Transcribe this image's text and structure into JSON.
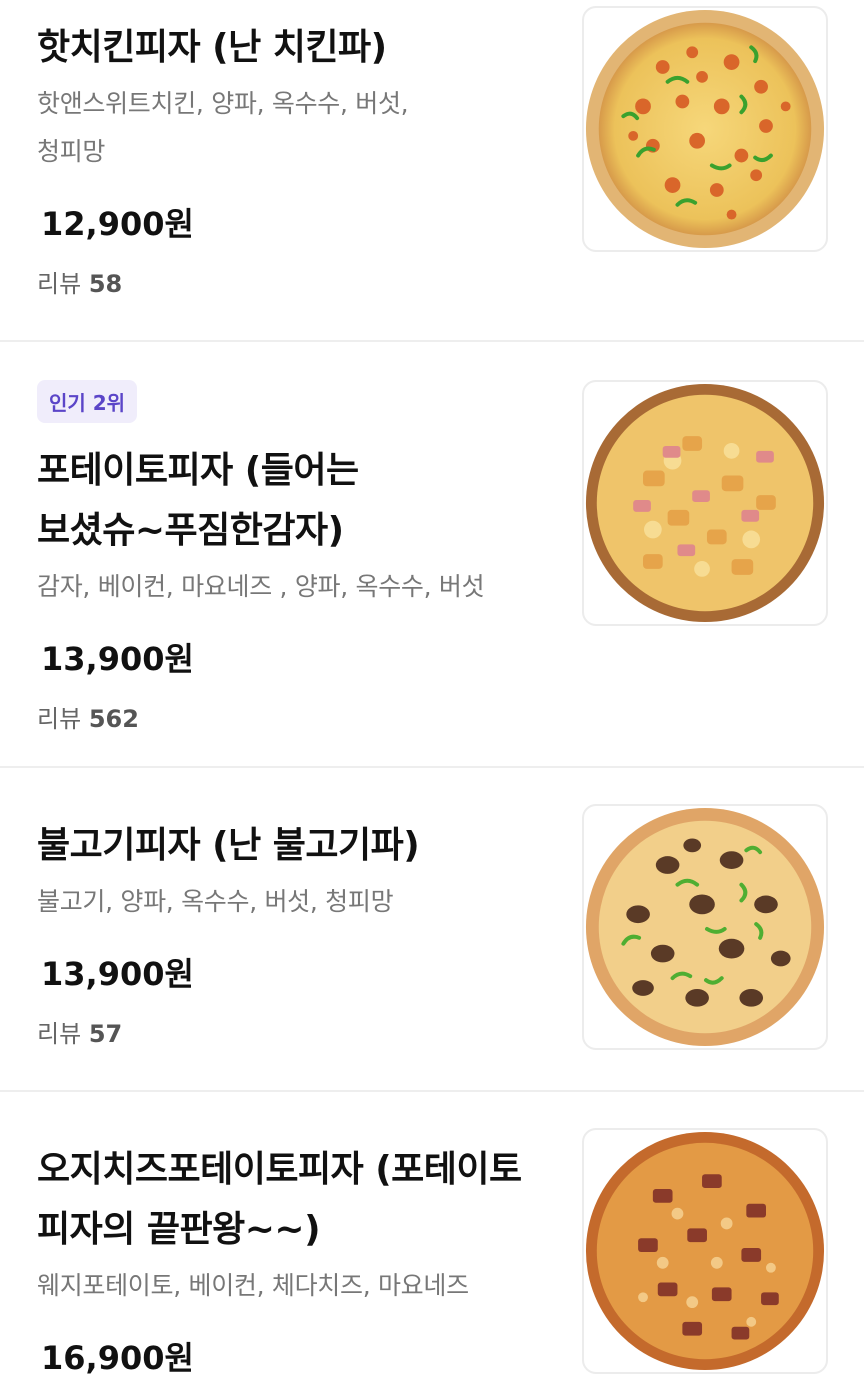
{
  "menu": {
    "items": [
      {
        "badge": "",
        "name": "핫치킨피자 (난 치킨파)",
        "desc_line1": "핫앤스위트치킨,  양파, 옥수수, 버섯,",
        "desc_line2": "청피망",
        "price": "12,900원",
        "review_label": "리뷰",
        "review_count": "58",
        "image_icon": "hot-chicken-pizza-photo"
      },
      {
        "badge": "인기 2위",
        "name_line1": "포테이토피자 (들어는",
        "name_line2": "보셨슈~푸짐한감자)",
        "desc_line1": "감자, 베이컨, 마요네즈 , 양파, 옥수수, 버섯",
        "price": "13,900원",
        "review_label": "리뷰",
        "review_count": "562",
        "image_icon": "potato-pizza-photo"
      },
      {
        "badge": "",
        "name": "불고기피자 (난 불고기파)",
        "desc_line1": "불고기, 양파, 옥수수, 버섯, 청피망",
        "price": "13,900원",
        "review_label": "리뷰",
        "review_count": "57",
        "image_icon": "bulgogi-pizza-photo"
      },
      {
        "badge": "",
        "name_line1": "오지치즈포테이토피자 (포테이토",
        "name_line2": "피자의 끝판왕~~)",
        "desc_line1": "웨지포테이토, 베이컨, 체다치즈, 마요네즈",
        "price": "16,900원",
        "image_icon": "ozzy-cheese-potato-pizza-photo"
      }
    ]
  },
  "colors": {
    "badge_bg": "#f0edfb",
    "badge_text": "#5b45c8",
    "desc_text": "#777777",
    "divider": "#eeeeee"
  }
}
